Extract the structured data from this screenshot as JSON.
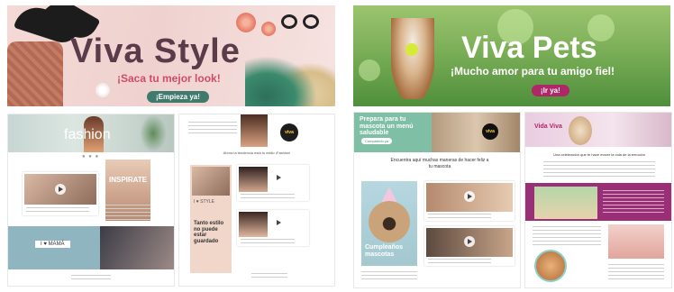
{
  "style": {
    "title": "Viva Style",
    "subtitle": "¡Saca tu mejor look!",
    "cta": "¡Empieza ya!",
    "mock_a": {
      "hero_label": "fashion",
      "inspirate": "INSPIRATE",
      "mama_label": "I ♥ MAMÁ",
      "dots": "● ● ●"
    },
    "mock_b": {
      "heading": "Ahora la tendencia está tu estilo ¡Fashion!",
      "viva_logo": "viva",
      "strip_label": "I ♥ STYLE",
      "strip_text": "Tanto estilo no puede estar guardado"
    }
  },
  "pets": {
    "title": "Viva Pets",
    "subtitle": "¡Mucho amor para tu amigo fiel!",
    "cta": "¡Ir ya!",
    "mock_c": {
      "hero_heading": "Prepara para tu mascota un menú saludable",
      "hero_button": "Compártelo ya",
      "viva_logo": "viva",
      "section_heading": "Encuentra aquí muchas maneras de hacer feliz a tu mascota",
      "pug_text": "Cumpleaños mascotas"
    },
    "mock_d": {
      "hero_tag": "Vida Viva",
      "line": "Una celebración que te hace mover la cola de la emoción"
    }
  }
}
